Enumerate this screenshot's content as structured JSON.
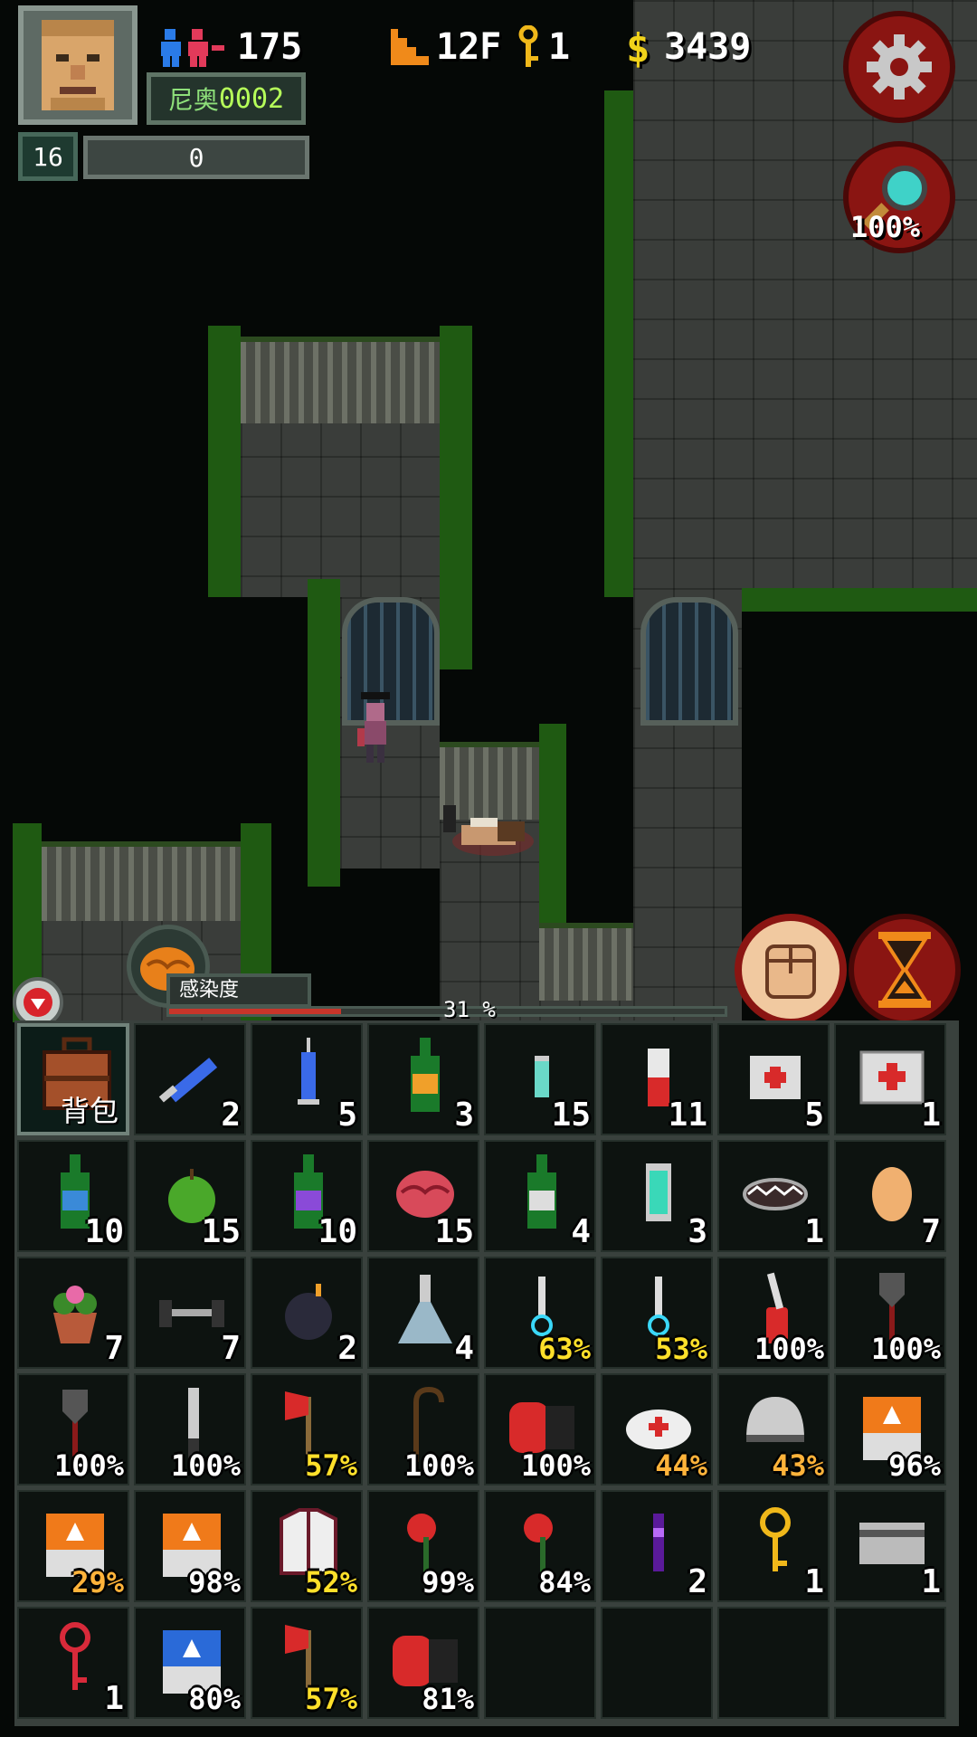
{
  "hud": {
    "survivors": "175",
    "floor": "12F",
    "keys": "1",
    "money": "3439",
    "name_prefix": "尼奥",
    "name_number": "0002",
    "level": "16",
    "exp": "0",
    "zoom": "100%"
  },
  "infection": {
    "label": "感染度",
    "percent_label": "31 %",
    "percent": 31
  },
  "inventory": {
    "bag_label": "背包",
    "items": [
      {
        "name": "large-syringe",
        "qty": "2",
        "color": "white"
      },
      {
        "name": "syringe",
        "qty": "5",
        "color": "white"
      },
      {
        "name": "green-bottle-orange-label",
        "qty": "3",
        "color": "white"
      },
      {
        "name": "small-green-vial",
        "qty": "15",
        "color": "white"
      },
      {
        "name": "red-pill-bottle",
        "qty": "11",
        "color": "white"
      },
      {
        "name": "bandage-box",
        "qty": "5",
        "color": "white"
      },
      {
        "name": "first-aid-kit",
        "qty": "1",
        "color": "white"
      },
      {
        "name": "green-bottle-blue-label",
        "qty": "10",
        "color": "white"
      },
      {
        "name": "green-apple",
        "qty": "15",
        "color": "white"
      },
      {
        "name": "purple-label-bottle",
        "qty": "10",
        "color": "white"
      },
      {
        "name": "brain",
        "qty": "15",
        "color": "white"
      },
      {
        "name": "green-bottle",
        "qty": "4",
        "color": "white"
      },
      {
        "name": "cyan-battery",
        "qty": "3",
        "color": "white"
      },
      {
        "name": "bear-trap",
        "qty": "1",
        "color": "white"
      },
      {
        "name": "egg",
        "qty": "7",
        "color": "white"
      },
      {
        "name": "flower-pot",
        "qty": "7",
        "color": "white"
      },
      {
        "name": "dumbbell",
        "qty": "7",
        "color": "white"
      },
      {
        "name": "bomb",
        "qty": "2",
        "color": "white"
      },
      {
        "name": "flask",
        "qty": "4",
        "color": "white"
      },
      {
        "name": "glow-stick-a",
        "qty": "63%",
        "color": "yellow"
      },
      {
        "name": "glow-stick-b",
        "qty": "53%",
        "color": "yellow"
      },
      {
        "name": "swiss-knife",
        "qty": "100%",
        "color": "white"
      },
      {
        "name": "shovel",
        "qty": "100%",
        "color": "white"
      },
      {
        "name": "shovel-2",
        "qty": "100%",
        "color": "white"
      },
      {
        "name": "knife",
        "qty": "100%",
        "color": "white"
      },
      {
        "name": "fire-axe",
        "qty": "57%",
        "color": "yellow"
      },
      {
        "name": "cane",
        "qty": "100%",
        "color": "white"
      },
      {
        "name": "boxing-glove",
        "qty": "100%",
        "color": "white"
      },
      {
        "name": "nurse-cap",
        "qty": "44%",
        "color": "orange"
      },
      {
        "name": "helmet",
        "qty": "43%",
        "color": "orange"
      },
      {
        "name": "orange-crate",
        "qty": "96%",
        "color": "white"
      },
      {
        "name": "orange-crate-2",
        "qty": "29%",
        "color": "orange"
      },
      {
        "name": "orange-crate-3",
        "qty": "98%",
        "color": "white"
      },
      {
        "name": "jacket",
        "qty": "52%",
        "color": "yellow"
      },
      {
        "name": "red-flower",
        "qty": "99%",
        "color": "white"
      },
      {
        "name": "red-flower-2",
        "qty": "84%",
        "color": "white"
      },
      {
        "name": "purple-vial",
        "qty": "2",
        "color": "white"
      },
      {
        "name": "gold-key",
        "qty": "1",
        "color": "white"
      },
      {
        "name": "keycard",
        "qty": "1",
        "color": "white"
      },
      {
        "name": "red-key",
        "qty": "1",
        "color": "white"
      },
      {
        "name": "blue-crate",
        "qty": "80%",
        "color": "white"
      },
      {
        "name": "fire-axe-2",
        "qty": "57%",
        "color": "yellow"
      },
      {
        "name": "boxing-glove-2",
        "qty": "81%",
        "color": "white"
      }
    ],
    "empty_slots": 4
  }
}
